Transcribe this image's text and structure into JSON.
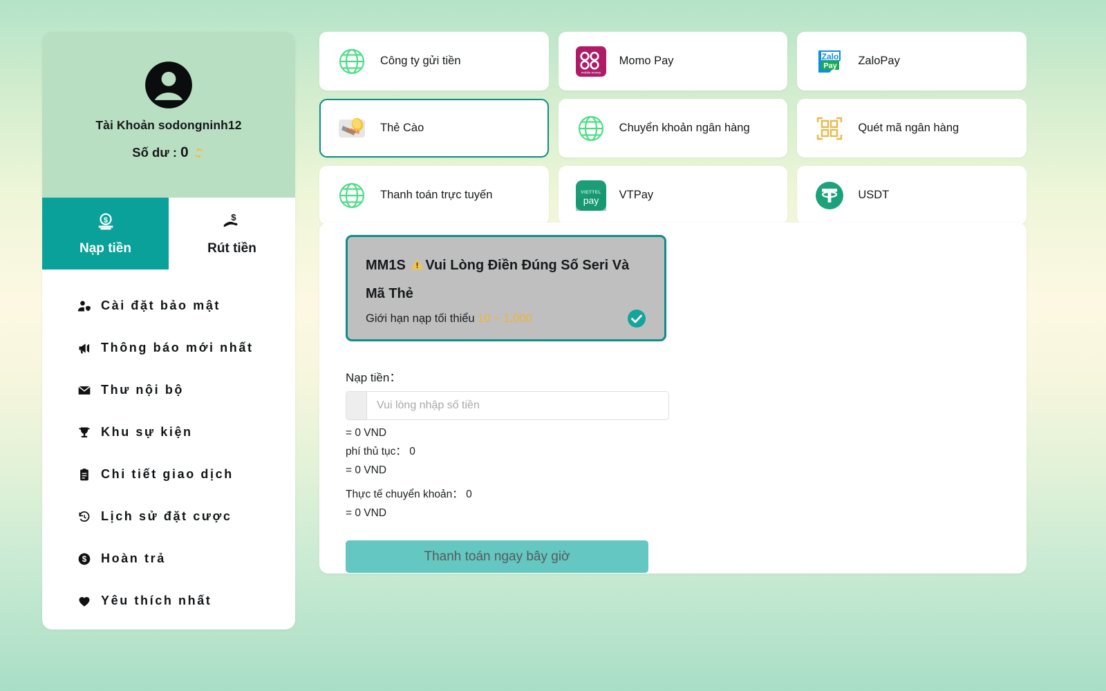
{
  "sidebar": {
    "account": {
      "avatar_icon": "user-circle-icon",
      "name": "Tài Khoản sodongninh12",
      "balance_label": "Số dư :",
      "balance_value": "0",
      "refresh_icon": "refresh-icon"
    },
    "tabs": [
      {
        "label": "Nạp tiền",
        "icon": "deposit-coin-icon",
        "active": true
      },
      {
        "label": "Rút tiền",
        "icon": "withdraw-hand-icon",
        "active": false
      }
    ],
    "menu": [
      {
        "label": "Cài đặt bảo mật",
        "icon": "user-shield-icon"
      },
      {
        "label": "Thông báo mới nhất",
        "icon": "megaphone-icon"
      },
      {
        "label": "Thư nội bộ",
        "icon": "envelope-icon"
      },
      {
        "label": "Khu sự kiện",
        "icon": "trophy-icon"
      },
      {
        "label": "Chi tiết giao dịch",
        "icon": "clipboard-icon"
      },
      {
        "label": "Lịch sử đặt cược",
        "icon": "history-clock-icon"
      },
      {
        "label": "Hoàn trả",
        "icon": "dollar-circle-icon"
      },
      {
        "label": "Yêu thích nhất",
        "icon": "heart-icon"
      }
    ]
  },
  "payment_methods": [
    {
      "label": "Công ty gửi tiền",
      "icon": "globe-icon",
      "selected": false
    },
    {
      "label": "Momo Pay",
      "icon": "momo-logo-icon",
      "selected": false
    },
    {
      "label": "ZaloPay",
      "icon": "zalopay-logo-icon",
      "selected": false
    },
    {
      "label": "Thẻ Cào",
      "icon": "scratch-card-icon",
      "selected": true
    },
    {
      "label": "Chuyển khoản ngân hàng",
      "icon": "globe-icon",
      "selected": false
    },
    {
      "label": "Quét mã ngân hàng",
      "icon": "qr-code-icon",
      "selected": false
    },
    {
      "label": "Thanh toán trực tuyến",
      "icon": "globe-icon",
      "selected": false
    },
    {
      "label": "VTPay",
      "icon": "viettelpay-logo-icon",
      "selected": false
    },
    {
      "label": "USDT",
      "icon": "tether-logo-icon",
      "selected": false
    }
  ],
  "product": {
    "title_prefix": "MM1S",
    "warning_icon": "warning-triangle-icon",
    "title_text": "Vui Lòng Điền Đúng Số Seri Và Mã Thẻ",
    "limit_label": "Giới hạn nạp tối thiểu",
    "limit_range": "10 ~ 1,000",
    "selected_icon": "check-circle-icon",
    "selected": true
  },
  "form": {
    "amount_label": "Nạp tiền：",
    "amount_value": "",
    "amount_placeholder": "Vui lòng nhập số tiền",
    "amount_vnd": "= 0 VND",
    "fee_label": "phí thủ tục：",
    "fee_value": "0",
    "fee_vnd": "= 0 VND",
    "actual_label": "Thực tế chuyển khoản：",
    "actual_value": "0",
    "actual_vnd": "= 0 VND",
    "submit_label": "Thanh toán ngay bây giờ"
  },
  "colors": {
    "accent_teal": "#09a199",
    "selected_border": "#0e8c85",
    "account_card_bg": "#b9dfc2",
    "button_bg": "#64c7c2",
    "limit_gold": "#f2b233",
    "globe_green": "#4ddd84"
  }
}
